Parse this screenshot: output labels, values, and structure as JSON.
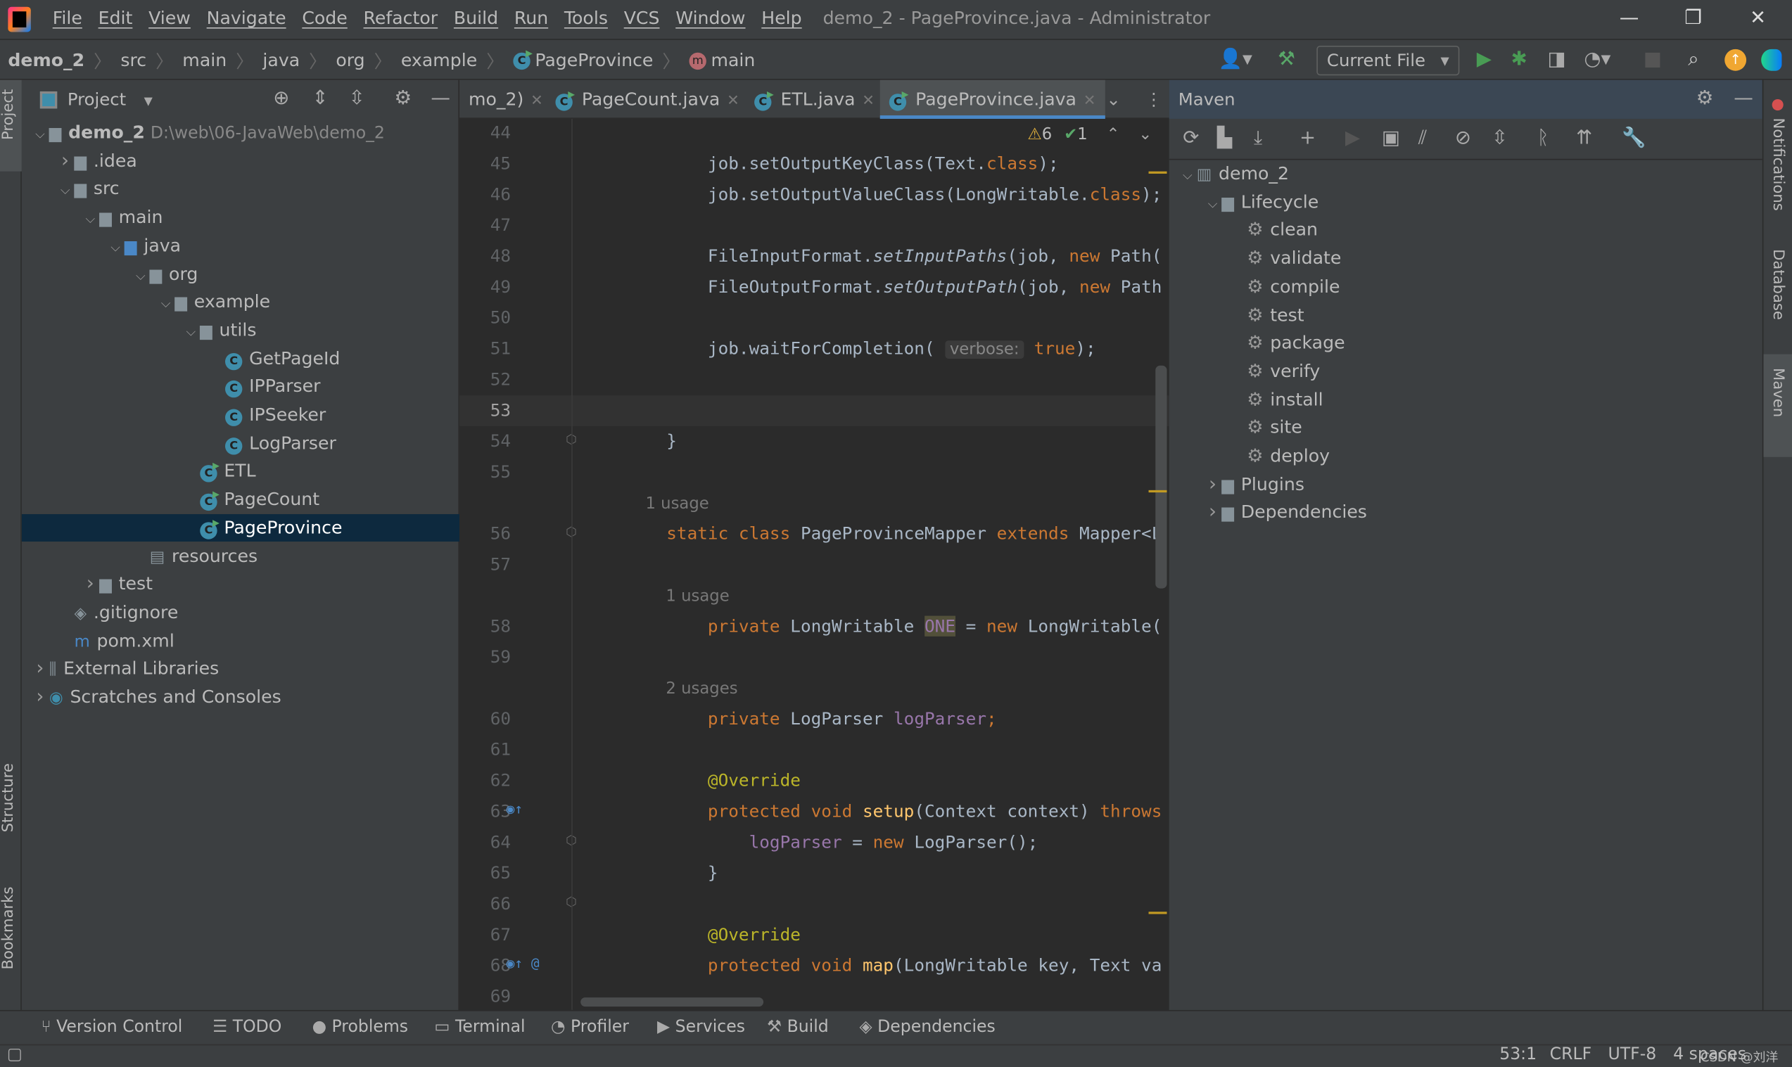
{
  "titlebar": {
    "menu": [
      "File",
      "Edit",
      "View",
      "Navigate",
      "Code",
      "Refactor",
      "Build",
      "Run",
      "Tools",
      "VCS",
      "Window",
      "Help"
    ],
    "title": "demo_2 - PageProvince.java - Administrator"
  },
  "breadcrumb": [
    "demo_2",
    "src",
    "main",
    "java",
    "org",
    "example",
    "PageProvince",
    "main"
  ],
  "toolbar": {
    "run_config": "Current File"
  },
  "project": {
    "title": "Project",
    "tree": [
      {
        "label": "demo_2",
        "path": "D:\\web\\06-JavaWeb\\demo_2",
        "level": 0,
        "arrow": "down",
        "icon": "module",
        "bold": true
      },
      {
        "label": ".idea",
        "level": 1,
        "arrow": "right",
        "icon": "folder"
      },
      {
        "label": "src",
        "level": 1,
        "arrow": "down",
        "icon": "folder"
      },
      {
        "label": "main",
        "level": 2,
        "arrow": "down",
        "icon": "folder"
      },
      {
        "label": "java",
        "level": 3,
        "arrow": "down",
        "icon": "source-folder"
      },
      {
        "label": "org",
        "level": 4,
        "arrow": "down",
        "icon": "package"
      },
      {
        "label": "example",
        "level": 5,
        "arrow": "down",
        "icon": "package"
      },
      {
        "label": "utils",
        "level": 6,
        "arrow": "down",
        "icon": "package"
      },
      {
        "label": "GetPageId",
        "level": 7,
        "icon": "class"
      },
      {
        "label": "IPParser",
        "level": 7,
        "icon": "class"
      },
      {
        "label": "IPSeeker",
        "level": 7,
        "icon": "class"
      },
      {
        "label": "LogParser",
        "level": 7,
        "icon": "class"
      },
      {
        "label": "ETL",
        "level": 6,
        "icon": "runnable-class"
      },
      {
        "label": "PageCount",
        "level": 6,
        "icon": "runnable-class"
      },
      {
        "label": "PageProvince",
        "level": 6,
        "icon": "runnable-class",
        "selected": true
      },
      {
        "label": "resources",
        "level": 4,
        "icon": "resources-folder"
      },
      {
        "label": "test",
        "level": 2,
        "arrow": "right",
        "icon": "folder"
      },
      {
        "label": ".gitignore",
        "level": 1,
        "icon": "gitignore"
      },
      {
        "label": "pom.xml",
        "level": 1,
        "icon": "maven"
      },
      {
        "label": "External Libraries",
        "level": 0,
        "arrow": "right",
        "icon": "libraries"
      },
      {
        "label": "Scratches and Consoles",
        "level": 0,
        "arrow": "right",
        "icon": "scratches"
      }
    ]
  },
  "editor": {
    "tabs": [
      {
        "label": "mo_2)"
      },
      {
        "label": "PageCount.java"
      },
      {
        "label": "ETL.java"
      },
      {
        "label": "PageProvince.java",
        "active": true
      }
    ],
    "inspections": {
      "warnings": "6",
      "ok": "1"
    },
    "lines": [
      {
        "n": "44",
        "t": []
      },
      {
        "n": "45",
        "t": [
          [
            "        job.setOutputKeyClass(Text.",
            ""
          ],
          [
            "class",
            "k"
          ],
          [
            ");",
            ""
          ]
        ]
      },
      {
        "n": "46",
        "t": [
          [
            "        job.setOutputValueClass(LongWritable.",
            ""
          ],
          [
            "class",
            "k"
          ],
          [
            ");",
            ""
          ]
        ]
      },
      {
        "n": "47",
        "t": []
      },
      {
        "n": "48",
        "t": [
          [
            "        FileInputFormat.",
            ""
          ],
          [
            "setInputPaths",
            "i"
          ],
          [
            "(job, ",
            ""
          ],
          [
            "new ",
            "k"
          ],
          [
            "Path(",
            ""
          ]
        ]
      },
      {
        "n": "49",
        "t": [
          [
            "        FileOutputFormat.",
            ""
          ],
          [
            "setOutputPath",
            "i"
          ],
          [
            "(job, ",
            ""
          ],
          [
            "new ",
            "k"
          ],
          [
            "Path",
            ""
          ]
        ]
      },
      {
        "n": "50",
        "t": []
      },
      {
        "n": "51",
        "t": [
          [
            "        job.waitForCompletion( ",
            ""
          ],
          [
            "verbose:",
            "ph"
          ],
          [
            " ",
            ""
          ],
          [
            "true",
            "k"
          ],
          [
            ");",
            ""
          ]
        ]
      },
      {
        "n": "52",
        "t": []
      },
      {
        "n": "53",
        "t": [],
        "current": true
      },
      {
        "n": "54",
        "t": [
          [
            "    }",
            ""
          ]
        ]
      },
      {
        "n": "55",
        "t": []
      },
      {
        "n": "",
        "t": [
          [
            "    1 usage",
            "hint"
          ]
        ]
      },
      {
        "n": "56",
        "t": [
          [
            "    ",
            ""
          ],
          [
            "static class ",
            "k"
          ],
          [
            "PageProvinceMapper ",
            ""
          ],
          [
            "extends ",
            "k"
          ],
          [
            "Mapper<L",
            ""
          ]
        ]
      },
      {
        "n": "57",
        "t": []
      },
      {
        "n": "",
        "t": [
          [
            "        1 usage",
            "hint"
          ]
        ]
      },
      {
        "n": "58",
        "t": [
          [
            "        ",
            ""
          ],
          [
            "private ",
            "k"
          ],
          [
            "LongWritable ",
            ""
          ],
          [
            "ONE",
            "v hl"
          ],
          [
            " = ",
            ""
          ],
          [
            "new ",
            "k"
          ],
          [
            "LongWritable(",
            ""
          ]
        ]
      },
      {
        "n": "59",
        "t": []
      },
      {
        "n": "",
        "t": [
          [
            "        2 usages",
            "hint"
          ]
        ]
      },
      {
        "n": "60",
        "t": [
          [
            "        ",
            ""
          ],
          [
            "private ",
            "k"
          ],
          [
            "LogParser ",
            ""
          ],
          [
            "logParser",
            "v"
          ],
          [
            ";",
            "k"
          ]
        ]
      },
      {
        "n": "61",
        "t": []
      },
      {
        "n": "62",
        "t": [
          [
            "        ",
            ""
          ],
          [
            "@Override",
            "a"
          ]
        ]
      },
      {
        "n": "63",
        "t": [
          [
            "        ",
            ""
          ],
          [
            "protected void ",
            "k"
          ],
          [
            "setup",
            "f"
          ],
          [
            "(Context context) ",
            ""
          ],
          [
            "throws",
            "k"
          ]
        ]
      },
      {
        "n": "64",
        "t": [
          [
            "            ",
            ""
          ],
          [
            "logParser",
            "v"
          ],
          [
            " = ",
            ""
          ],
          [
            "new ",
            "k"
          ],
          [
            "LogParser();",
            ""
          ]
        ]
      },
      {
        "n": "65",
        "t": [
          [
            "        }",
            ""
          ]
        ]
      },
      {
        "n": "66",
        "t": []
      },
      {
        "n": "67",
        "t": [
          [
            "        ",
            ""
          ],
          [
            "@Override",
            "a"
          ]
        ]
      },
      {
        "n": "68",
        "t": [
          [
            "        ",
            ""
          ],
          [
            "protected void ",
            "k"
          ],
          [
            "map",
            "f"
          ],
          [
            "(LongWritable key, Text va",
            ""
          ]
        ]
      },
      {
        "n": "69",
        "t": []
      }
    ]
  },
  "maven": {
    "title": "Maven",
    "tree": [
      {
        "label": "demo_2",
        "level": 0,
        "arrow": "down",
        "icon": "maven-project"
      },
      {
        "label": "Lifecycle",
        "level": 1,
        "arrow": "down",
        "icon": "lifecycle-folder"
      },
      {
        "label": "clean",
        "level": 2,
        "icon": "gear"
      },
      {
        "label": "validate",
        "level": 2,
        "icon": "gear"
      },
      {
        "label": "compile",
        "level": 2,
        "icon": "gear"
      },
      {
        "label": "test",
        "level": 2,
        "icon": "gear"
      },
      {
        "label": "package",
        "level": 2,
        "icon": "gear"
      },
      {
        "label": "verify",
        "level": 2,
        "icon": "gear"
      },
      {
        "label": "install",
        "level": 2,
        "icon": "gear"
      },
      {
        "label": "site",
        "level": 2,
        "icon": "gear"
      },
      {
        "label": "deploy",
        "level": 2,
        "icon": "gear"
      },
      {
        "label": "Plugins",
        "level": 1,
        "arrow": "right",
        "icon": "plugins-folder"
      },
      {
        "label": "Dependencies",
        "level": 1,
        "arrow": "right",
        "icon": "dependencies-folder"
      }
    ]
  },
  "left_stripe": {
    "project": "Project",
    "structure": "Structure",
    "bookmarks": "Bookmarks"
  },
  "right_stripe": {
    "notifications": "Notifications",
    "database": "Database",
    "maven": "Maven"
  },
  "bottom_tabs": [
    "Version Control",
    "TODO",
    "Problems",
    "Terminal",
    "Profiler",
    "Services",
    "Build",
    "Dependencies"
  ],
  "status": {
    "position": "53:1",
    "line_sep": "CRLF",
    "encoding": "UTF-8",
    "indent": "4 spaces",
    "watermark": "CSDN @刘洋988"
  }
}
